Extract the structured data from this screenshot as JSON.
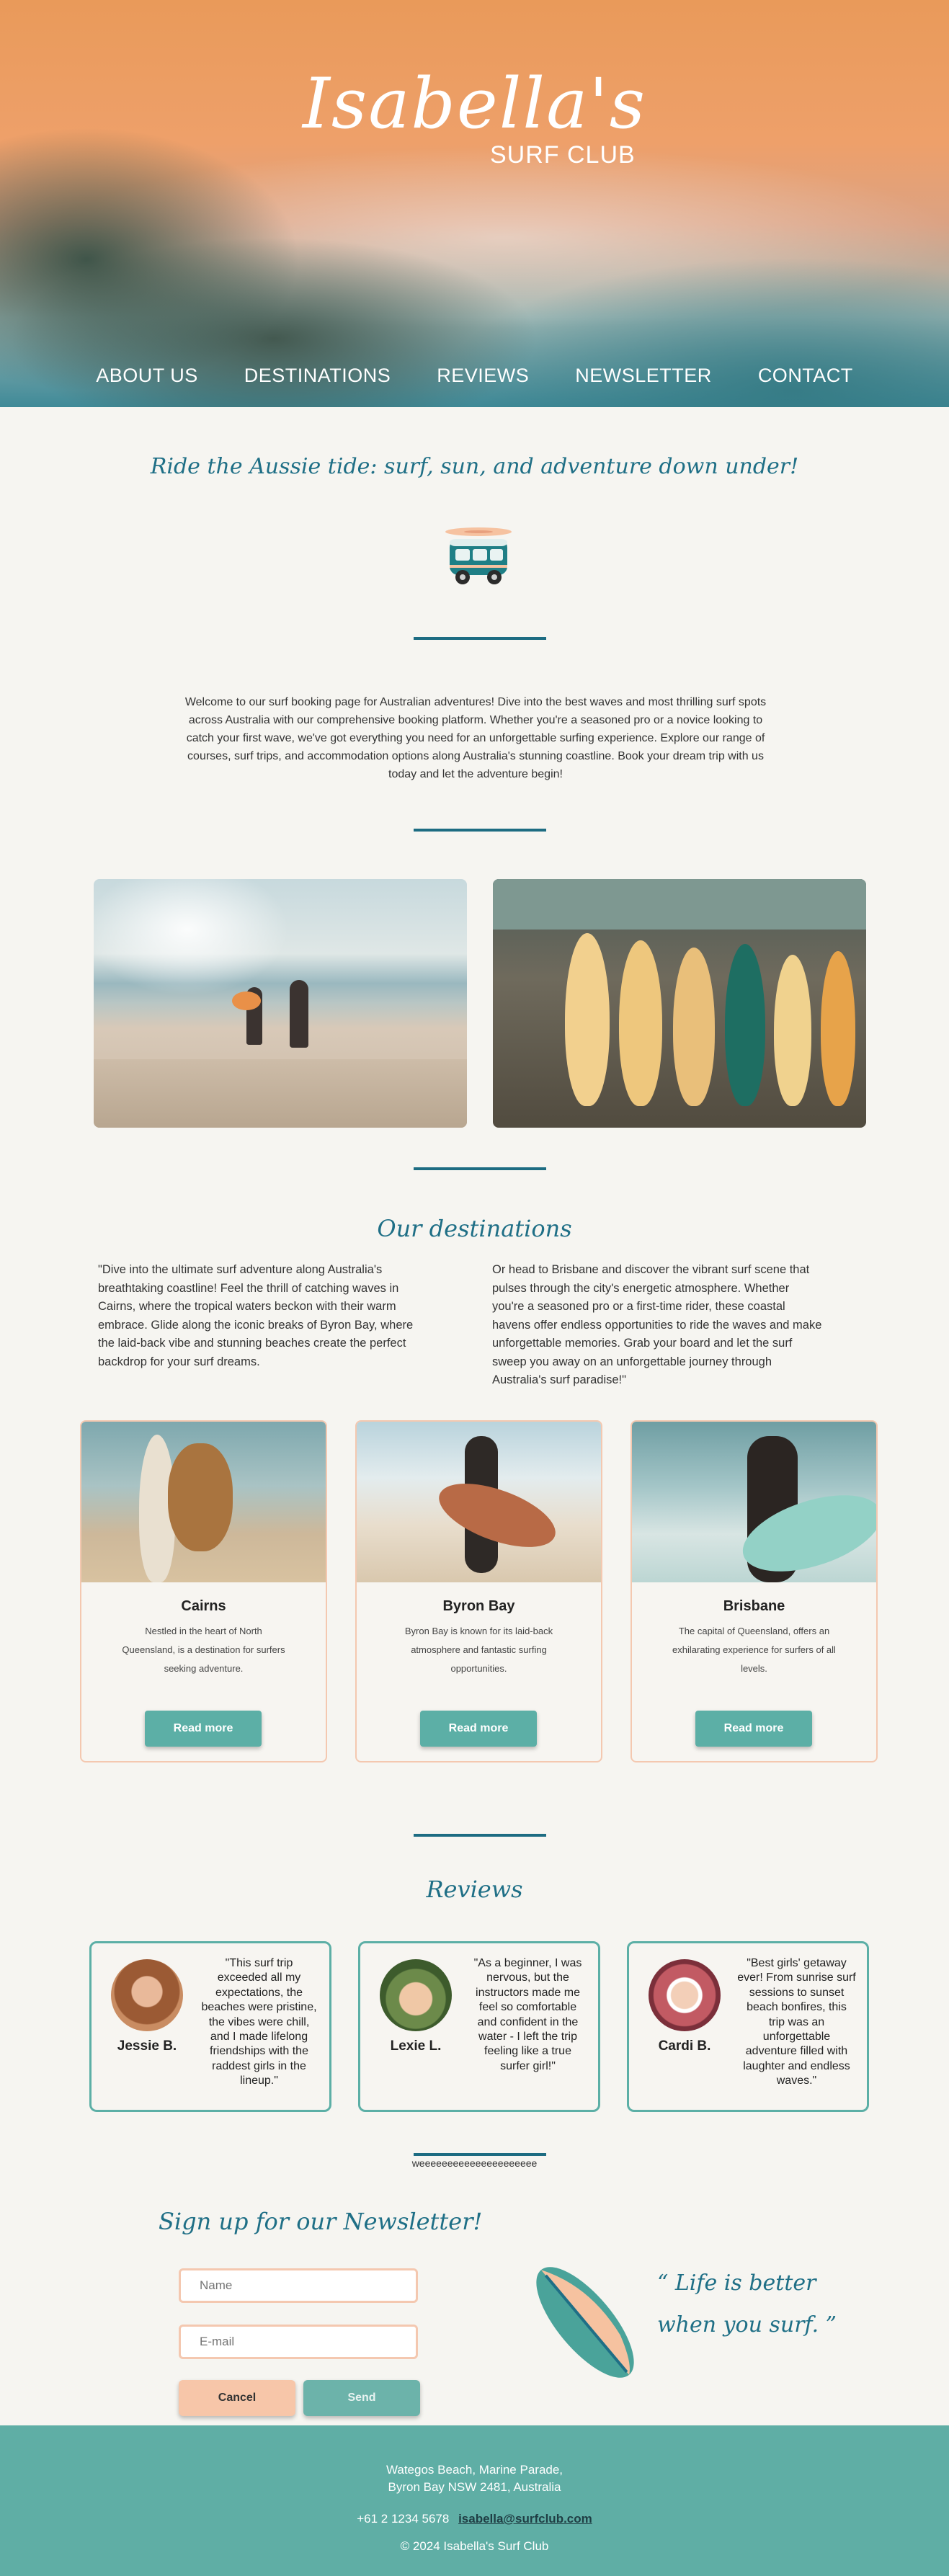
{
  "hero": {
    "title": "Isabella's",
    "subtitle": "SURF CLUB"
  },
  "nav": {
    "items": [
      "ABOUT US",
      "DESTINATIONS",
      "REVIEWS",
      "NEWSLETTER",
      "CONTACT"
    ]
  },
  "intro": {
    "tagline": "Ride the Aussie tide: surf, sun, and adventure down under!",
    "text": "Welcome to our surf booking page for Australian adventures! Dive into the best waves and most thrilling surf spots across Australia with our comprehensive booking platform. Whether you're a seasoned pro or a novice looking to catch your first wave, we've got everything you need for an unforgettable surfing experience. Explore our range of courses, surf trips, and accommodation options along Australia's stunning coastline. Book your dream trip with us today and let the adventure begin!"
  },
  "destinations": {
    "title": "Our destinations",
    "left_text": "\"Dive into the ultimate surf adventure along Australia's breathtaking coastline! Feel the thrill of catching waves in Cairns, where the tropical waters beckon with their warm embrace. Glide along the iconic breaks of Byron Bay, where the laid-back vibe and stunning beaches create the perfect backdrop for your surf dreams.",
    "right_text": "Or head to Brisbane and discover the vibrant surf scene that pulses through the city's energetic atmosphere. Whether you're a seasoned pro or a first-time rider, these coastal havens offer endless opportunities to ride the waves and make unforgettable memories. Grab your board and let the surf sweep you away on an unforgettable journey through Australia's surf paradise!\"",
    "cards": [
      {
        "name": "Cairns",
        "desc": "Nestled in the heart of North Queensland, is a destination for surfers seeking adventure.",
        "button": "Read more"
      },
      {
        "name": "Byron Bay",
        "desc": "Byron Bay is known for its laid-back atmosphere and fantastic surfing opportunities.",
        "button": "Read more"
      },
      {
        "name": "Brisbane",
        "desc": "The capital of Queensland, offers an exhilarating experience for surfers of all levels.",
        "button": "Read more"
      }
    ]
  },
  "reviews": {
    "title": "Reviews",
    "items": [
      {
        "name": "Jessie B.",
        "quote": "\"This surf trip exceeded all my expectations, the beaches were pristine, the vibes were chill, and I made lifelong friendships with the raddest girls in the lineup.\""
      },
      {
        "name": "Lexie L.",
        "quote": "\"As a beginner, I was nervous, but the instructors made me feel so comfortable and confident in the water - I left the trip feeling like a true surfer girl!\""
      },
      {
        "name": "Cardi B.",
        "quote": "\"Best girls' getaway ever! From sunrise surf sessions to sunset beach bonfires, this trip was an unforgettable adventure filled with laughter and endless waves.\""
      }
    ]
  },
  "newsletter": {
    "filler": "weeeeeeeeeeeeeeeeeeeee",
    "title": "Sign up for our Newsletter!",
    "name_placeholder": "Name",
    "email_placeholder": "E-mail",
    "cancel_label": "Cancel",
    "send_label": "Send",
    "quote_line1": "“ Life is better",
    "quote_line2": "when you surf. ”"
  },
  "footer": {
    "address_line1": "Wategos Beach, Marine Parade,",
    "address_line2": "Byron Bay NSW 2481, Australia",
    "phone": "+61 2 1234 5678",
    "email": "isabella@surfclub.com",
    "copyright": "© 2024 Isabella's Surf Club"
  },
  "colors": {
    "teal_accent": "#5cafa6",
    "dark_teal": "#1f6f86",
    "peach": "#f4c8b0",
    "background": "#f6f5f1"
  }
}
